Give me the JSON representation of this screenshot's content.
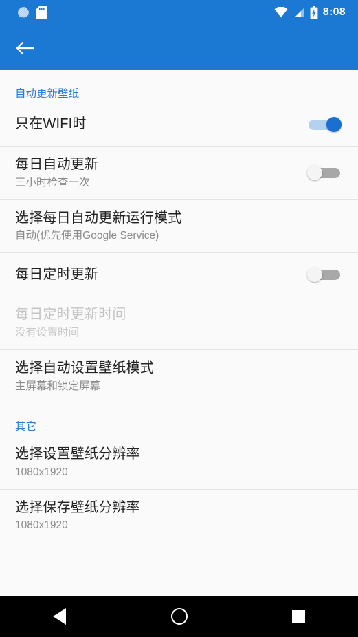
{
  "statusbar": {
    "time": "8:08",
    "left_icons": [
      "sync-icon",
      "sd-card-icon"
    ],
    "right_icons": [
      "wifi-icon",
      "cellular-signal-icon",
      "battery-charging-icon"
    ],
    "background_color": "#1b79d4"
  },
  "toolbar": {
    "back_icon": "back-arrow-icon",
    "background_color": "#1b79d4"
  },
  "colors": {
    "accent": "#2a7ad4",
    "switch_on": "#1b6fd0",
    "switch_off_track": "#a8a8a8",
    "page_background": "#fafafa",
    "divider": "#e4e4e4"
  },
  "sections": [
    {
      "header": "自动更新壁纸",
      "rows": [
        {
          "title": "只在WIFI时",
          "subtitle": "",
          "control": "switch",
          "switch_state": "on",
          "enabled": true
        },
        {
          "title": "每日自动更新",
          "subtitle": "三小时检查一次",
          "control": "switch",
          "switch_state": "off",
          "enabled": true
        },
        {
          "title": "选择每日自动更新运行模式",
          "subtitle": "自动(优先使用Google Service)",
          "control": "none",
          "enabled": true
        },
        {
          "title": "每日定时更新",
          "subtitle": "",
          "control": "switch",
          "switch_state": "off",
          "enabled": true
        },
        {
          "title": "每日定时更新时间",
          "subtitle": "没有设置时间",
          "control": "none",
          "enabled": false
        },
        {
          "title": "选择自动设置壁纸模式",
          "subtitle": "主屏幕和锁定屏幕",
          "control": "none",
          "enabled": true
        }
      ]
    },
    {
      "header": "其它",
      "rows": [
        {
          "title": "选择设置壁纸分辨率",
          "subtitle": "1080x1920",
          "control": "none",
          "enabled": true
        },
        {
          "title": "选择保存壁纸分辨率",
          "subtitle": "1080x1920",
          "control": "none",
          "enabled": true
        }
      ]
    }
  ],
  "navbar": {
    "back_label": "back-button",
    "home_label": "home-button",
    "recents_label": "recents-button"
  }
}
